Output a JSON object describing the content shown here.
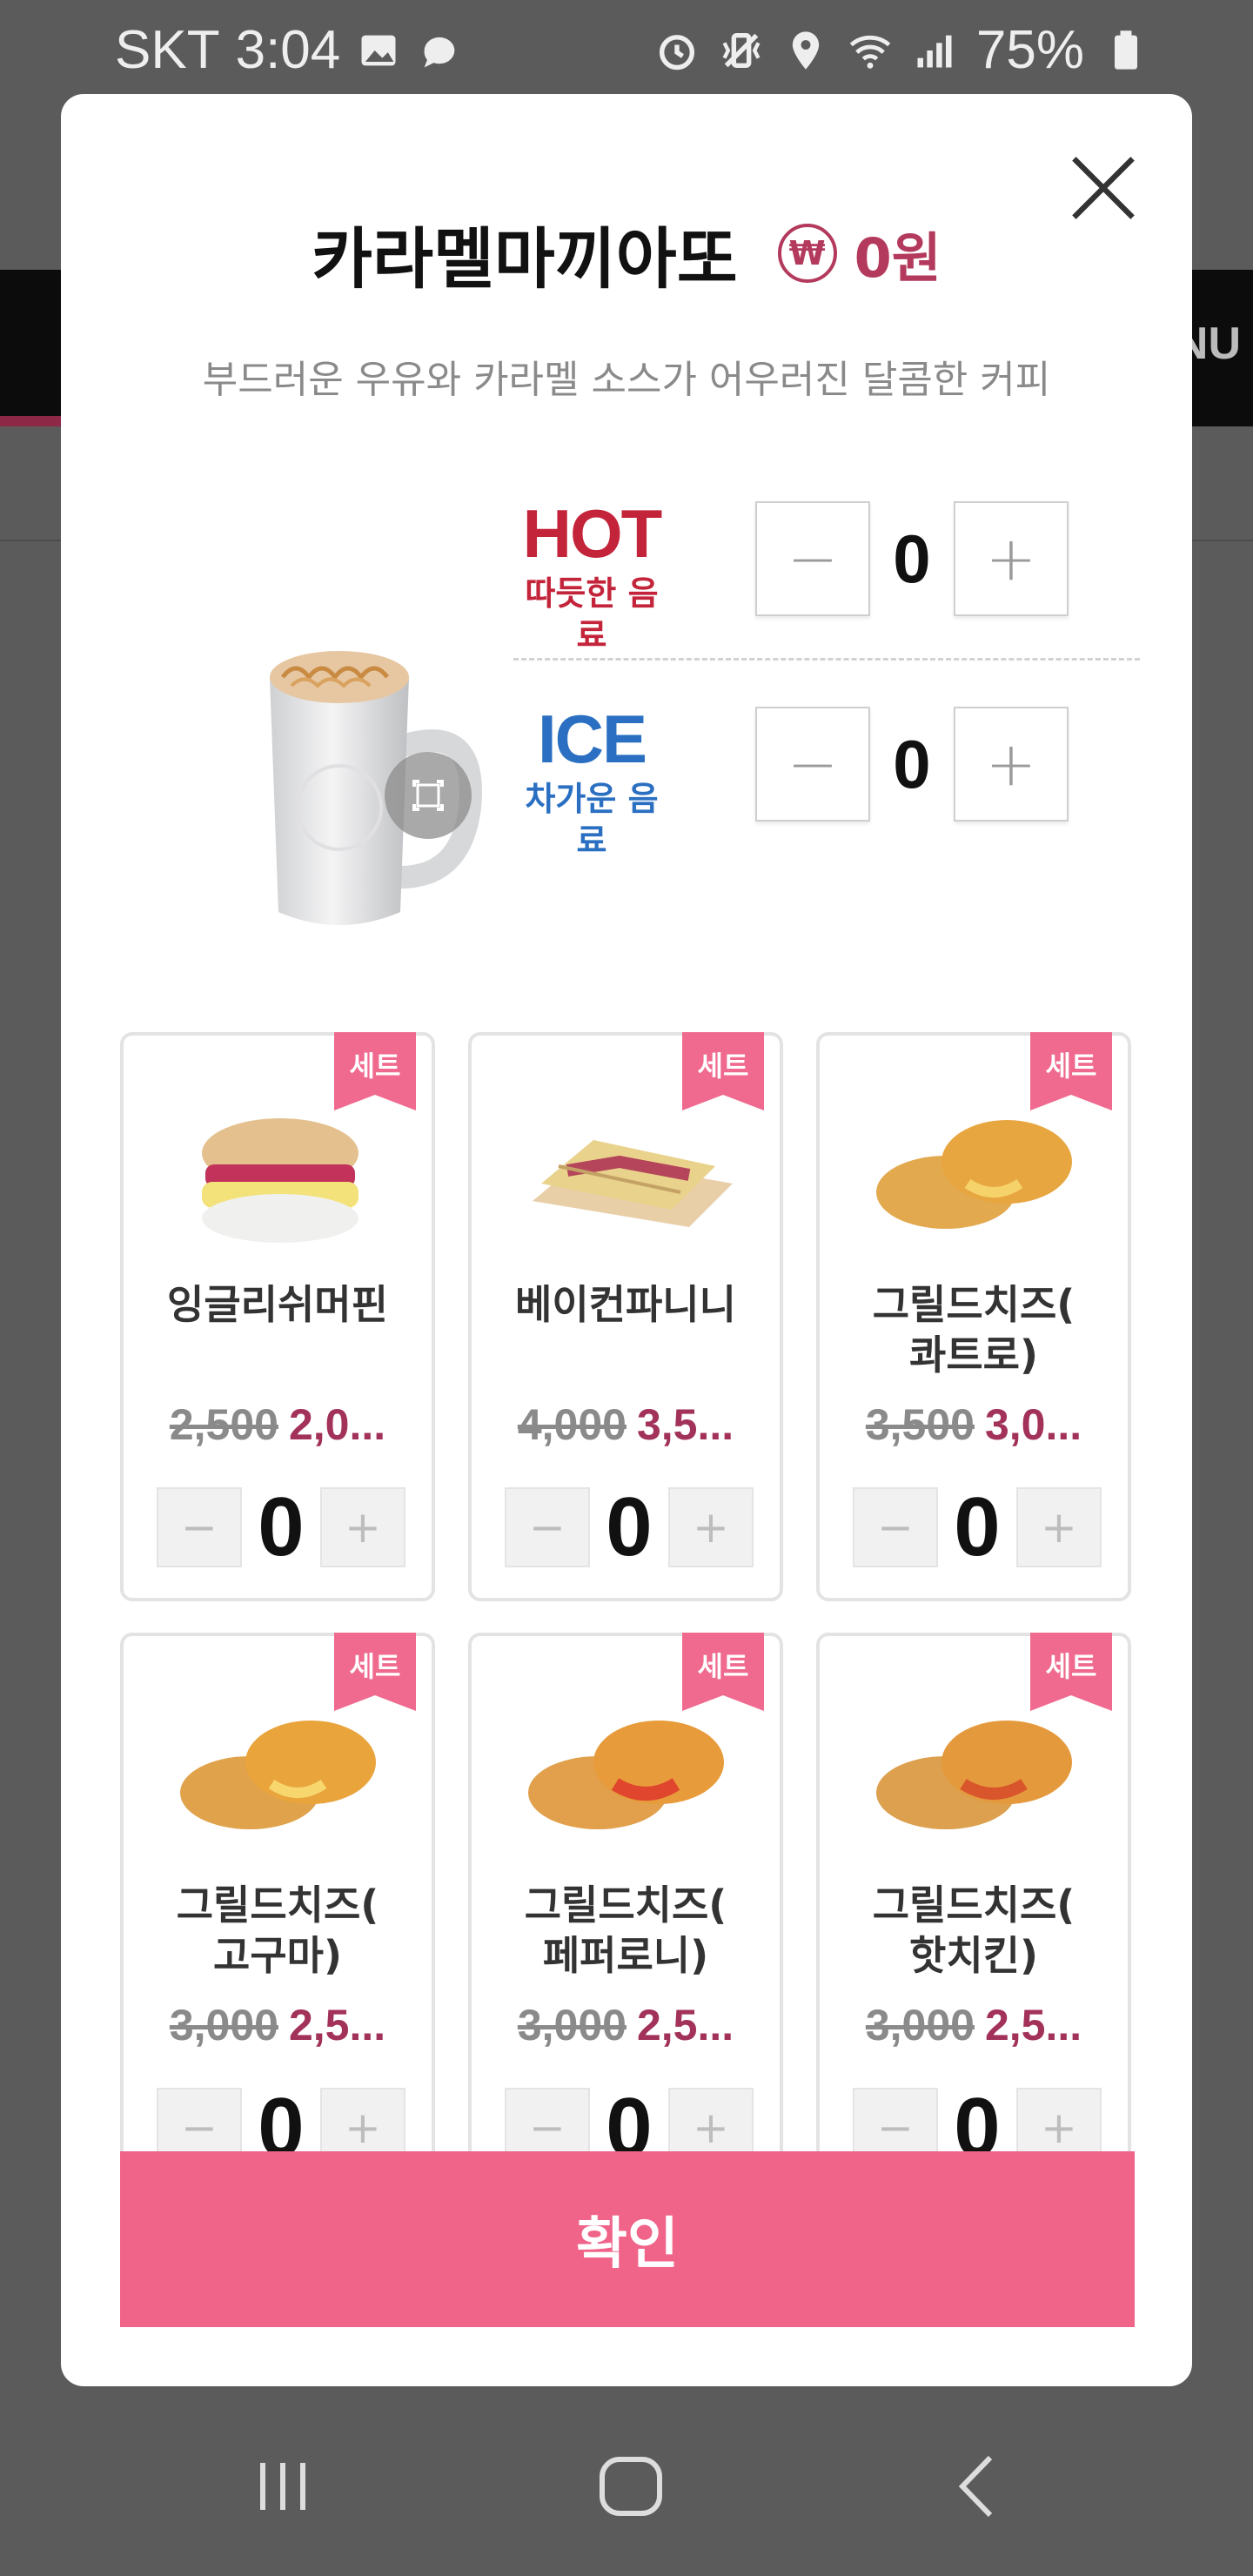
{
  "status_bar": {
    "carrier": "SKT",
    "time": "3:04",
    "battery": "75%",
    "icons": [
      "image-icon",
      "chat-bubble-icon",
      "alarm-icon",
      "vibrate-icon",
      "location-icon",
      "wifi-icon",
      "signal-icon",
      "battery-icon"
    ]
  },
  "background_app": {
    "nav_right_fragment": "NU"
  },
  "modal": {
    "title": "카라멜마끼아또",
    "currency_symbol": "₩",
    "price": "0원",
    "subtitle": "부드러운 우유와 카라멜 소스가 어우러진 달콤한 커피",
    "options": [
      {
        "name": "HOT",
        "desc": "따듯한 음료",
        "qty": "0",
        "color": "#c3243a"
      },
      {
        "name": "ICE",
        "desc": "차가운 음료",
        "qty": "0",
        "color": "#2a6fc1"
      }
    ],
    "stepper": {
      "minus": "−",
      "plus": "+"
    },
    "set_badge": "세트",
    "sets": [
      {
        "name": "잉글리쉬머핀",
        "old_price": "2,500",
        "new_price": "2,0...",
        "qty": "0"
      },
      {
        "name": "베이컨파니니",
        "old_price": "4,000",
        "new_price": "3,5...",
        "qty": "0"
      },
      {
        "name": "그릴드치즈(\n콰트로)",
        "old_price": "3,500",
        "new_price": "3,0...",
        "qty": "0"
      },
      {
        "name": "그릴드치즈(\n고구마)",
        "old_price": "3,000",
        "new_price": "2,5...",
        "qty": "0"
      },
      {
        "name": "그릴드치즈(\n페퍼로니)",
        "old_price": "3,000",
        "new_price": "2,5...",
        "qty": "0"
      },
      {
        "name": "그릴드치즈(\n핫치킨)",
        "old_price": "3,000",
        "new_price": "2,5...",
        "qty": "0"
      }
    ],
    "confirm_label": "확인"
  },
  "colors": {
    "accent_pink": "#f0648a",
    "price_red": "#a2325a",
    "hot_red": "#c3243a",
    "ice_blue": "#2a6fc1"
  }
}
